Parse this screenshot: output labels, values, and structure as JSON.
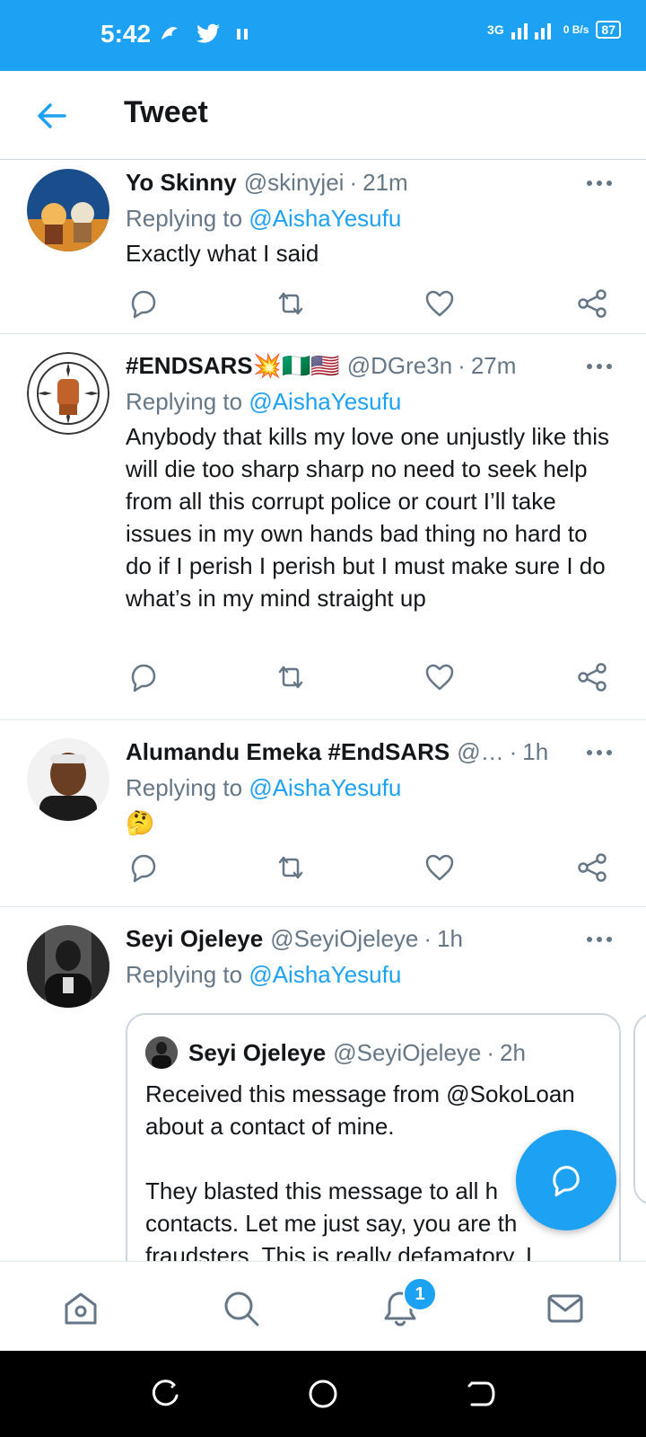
{
  "status_bar": {
    "time": "5:42",
    "network": "3G",
    "data_rate": "0 B/s",
    "battery": "87"
  },
  "header": {
    "title": "Tweet",
    "back_icon": "arrow-left-icon"
  },
  "tweets": [
    {
      "name": "Yo Skinny",
      "handle": "@skinyjei",
      "time": "21m",
      "replying_prefix": "Replying to",
      "replying_to": "@AishaYesufu",
      "text": "Exactly what I said"
    },
    {
      "name": "#ENDSARS💥🇳🇬🇺🇸",
      "handle": "@DGre3n",
      "time": "27m",
      "replying_prefix": "Replying to",
      "replying_to": "@AishaYesufu",
      "text": "Anybody that kills my love one unjustly like this will die too sharp sharp no need to seek help from all this corrupt police or court I’ll take issues in my own hands bad thing no hard to do if I perish I perish but I must make sure I do what’s in my mind straight up"
    },
    {
      "name": "Alumandu Emeka #EndSARS",
      "handle": "@…",
      "time": "1h",
      "replying_prefix": "Replying to",
      "replying_to": "@AishaYesufu",
      "text": "🤔"
    },
    {
      "name": "Seyi Ojeleye",
      "handle": "@SeyiOjeleye",
      "time": "1h",
      "replying_prefix": "Replying to",
      "replying_to": "@AishaYesufu",
      "text": ""
    }
  ],
  "quoted_tweet": {
    "name": "Seyi Ojeleye",
    "handle": "@SeyiOjeleye",
    "time": "2h",
    "text": "Received this message from @SokoLoan\n about a contact of mine.\n\nThey blasted this message to all h\ncontacts. Let me just say, you are th\nfraudsters. This is really defamatory. I"
  },
  "separator": "·",
  "notifications_badge": "1",
  "colors": {
    "accent": "#1da1f2",
    "secondary_text": "#657786",
    "primary_text": "#14171a"
  },
  "icons": {
    "actions": [
      "reply-icon",
      "retweet-icon",
      "like-icon",
      "share-icon"
    ],
    "nav": [
      "home-icon",
      "search-icon",
      "notifications-icon",
      "messages-icon"
    ]
  }
}
